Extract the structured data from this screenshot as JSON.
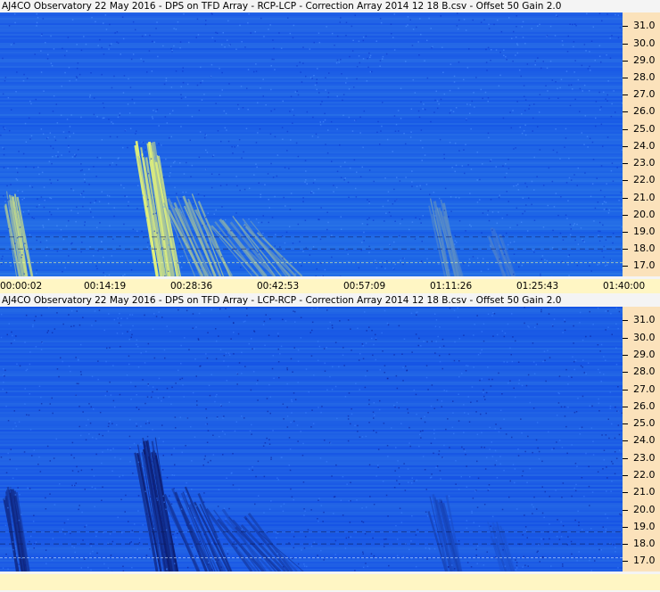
{
  "panels": [
    {
      "title": "AJ4CO Observatory 22 May 2016  -  DPS on TFD Array  -  RCP-LCP  -  Correction Array 2014 12 18 B.csv  -  Offset 50  Gain 2.0",
      "polarity": "positive"
    },
    {
      "title": "AJ4CO Observatory 22 May 2016  -  DPS on TFD Array  -  LCP-RCP  -  Correction Array 2014 12 18 B.csv  -  Offset 50  Gain 2.0",
      "polarity": "negative"
    }
  ],
  "chart_data": {
    "type": "heatmap",
    "xlabel": "",
    "ylabel": "",
    "x_ticks": [
      "00:00:02",
      "00:14:19",
      "00:28:36",
      "00:42:53",
      "00:57:09",
      "01:11:26",
      "01:25:43",
      "01:40:00"
    ],
    "y_ticks": [
      "17.0",
      "18.0",
      "19.0",
      "20.0",
      "21.0",
      "22.0",
      "23.0",
      "24.0",
      "25.0",
      "26.0",
      "27.0",
      "28.0",
      "29.0",
      "30.0",
      "31.0"
    ],
    "x_range_minutes": [
      0.03,
      100.0
    ],
    "y_range": [
      16.4,
      31.8
    ],
    "colors": {
      "background": "#1f5fe8",
      "positive_peak": "#f4ff70",
      "negative_peak": "#0a1460",
      "axis_bg": "#fbe2bb",
      "time_bg": "#fff6c4"
    },
    "features": [
      {
        "kind": "burst-arc",
        "t_start": 0.5,
        "t_end": 4.2,
        "f_high": 21.5,
        "f_low": 16.4,
        "strength": 0.8
      },
      {
        "kind": "burst-arc",
        "t_start": 21.5,
        "t_end": 28.0,
        "f_high": 24.4,
        "f_low": 16.4,
        "strength": 1.0
      },
      {
        "kind": "burst-arc",
        "t_start": 26.0,
        "t_end": 37.0,
        "f_high": 21.5,
        "f_low": 16.4,
        "strength": 0.7
      },
      {
        "kind": "burst-arc",
        "t_start": 33.0,
        "t_end": 48.0,
        "f_high": 20.3,
        "f_low": 16.4,
        "strength": 0.55
      },
      {
        "kind": "burst-arc",
        "t_start": 68.5,
        "t_end": 73.5,
        "f_high": 21.0,
        "f_low": 16.4,
        "strength": 0.45
      },
      {
        "kind": "burst-arc",
        "t_start": 78.0,
        "t_end": 82.0,
        "f_high": 19.5,
        "f_low": 16.4,
        "strength": 0.25
      }
    ]
  }
}
